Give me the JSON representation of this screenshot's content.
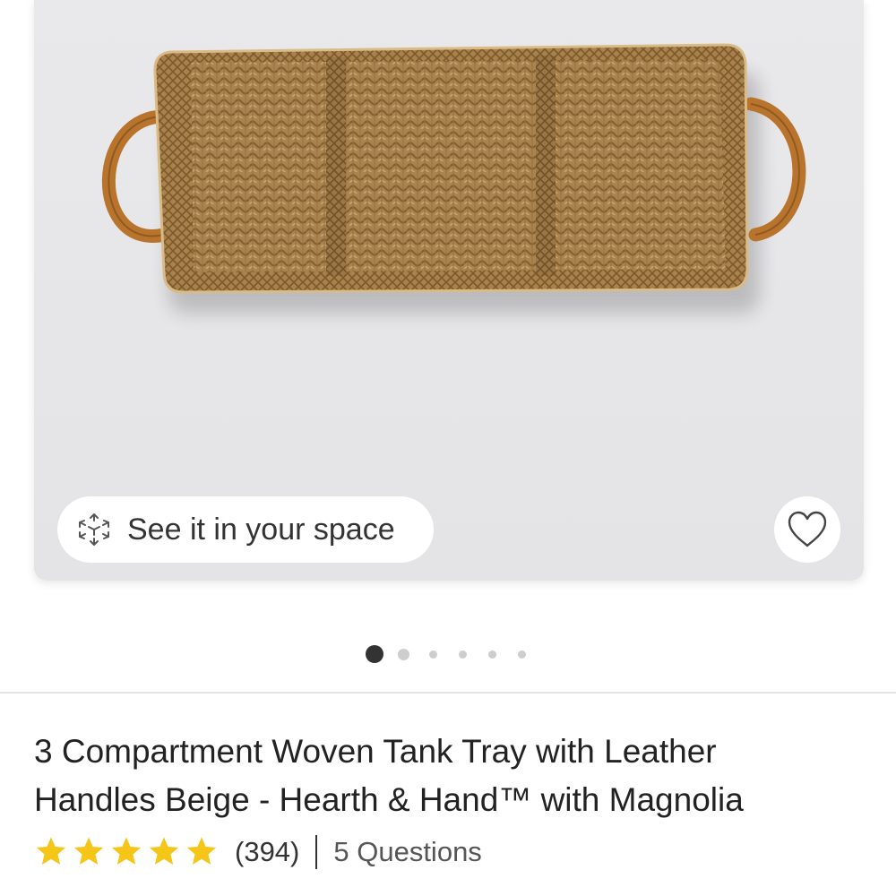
{
  "product": {
    "image_alt": "3 compartment woven tray with leather handles",
    "title_line1": "3 Compartment Woven Tank Tray with Leather",
    "title_line2": "Handles Beige - Hearth & Hand™ with Magnolia",
    "rating": 5,
    "review_count": "(394)",
    "questions_label": "5 Questions"
  },
  "ar": {
    "label": "See it in your space",
    "icon": "ar-cube-icon"
  },
  "favorite": {
    "icon": "heart-outline-icon"
  },
  "carousel": {
    "count": 6,
    "active_index": 0
  },
  "colors": {
    "star": "#f5c518",
    "active_dot": "#333333",
    "inactive_dot": "#cdcdcd",
    "card_background": "#e7e7e9",
    "leather": "#b8742c",
    "straw": "#b08a52"
  }
}
